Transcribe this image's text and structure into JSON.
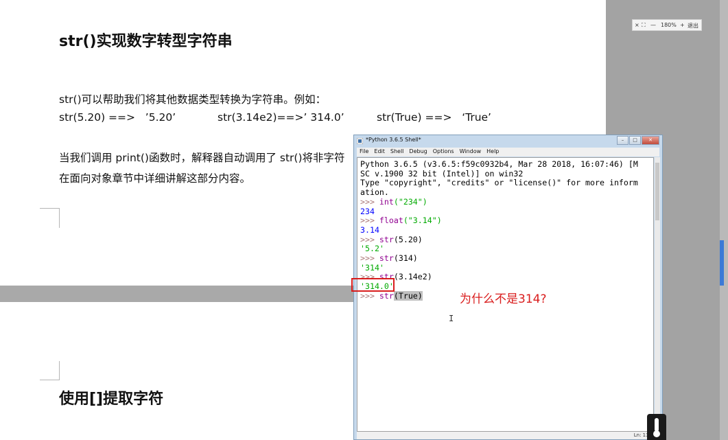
{
  "document": {
    "heading1": "str()实现数字转型字符串",
    "para1": "str()可以帮助我们将其他数据类型转换为字符串。例如：",
    "examples": [
      "str(5.20) ==>   ’5.20’",
      "str(3.14e2)==>’ 314.0’",
      "str(True) ==>   ‘True’"
    ],
    "para2_line1": "当我们调用 print()函数时，解释器自动调用了 str()将非字符",
    "para2_line2": "在面向对象章节中详细讲解这部分内容。",
    "heading2": "使用[]提取字符"
  },
  "zoom": {
    "level": "180%",
    "minus": "—",
    "plus": "+",
    "exit": "退出"
  },
  "python_window": {
    "title": "*Python 3.6.5 Shell*",
    "menu": [
      "File",
      "Edit",
      "Shell",
      "Debug",
      "Options",
      "Window",
      "Help"
    ],
    "status": "Ln: 13  Co",
    "lines": [
      {
        "kind": "plain",
        "text": "Python 3.6.5 (v3.6.5:f59c0932b4, Mar 28 2018, 16:07:46) [M"
      },
      {
        "kind": "plain",
        "text": "SC v.1900 32 bit (Intel)] on win32"
      },
      {
        "kind": "plain",
        "text": "Type \"copyright\", \"credits\" or \"license()\" for more inform"
      },
      {
        "kind": "plain",
        "text": "ation."
      },
      {
        "kind": "cmd",
        "prompt": ">>> ",
        "fn": "int",
        "arg": "(\"234\")"
      },
      {
        "kind": "out",
        "text": "234"
      },
      {
        "kind": "cmd",
        "prompt": ">>> ",
        "fn": "float",
        "arg": "(\"3.14\")"
      },
      {
        "kind": "out",
        "text": "3.14"
      },
      {
        "kind": "cmd",
        "prompt": ">>> ",
        "fn": "str",
        "arg": "(5.20)"
      },
      {
        "kind": "out",
        "text": "'5.2'"
      },
      {
        "kind": "cmd",
        "prompt": ">>> ",
        "fn": "str",
        "arg": "(314)"
      },
      {
        "kind": "out",
        "text": "'314'"
      },
      {
        "kind": "cmd",
        "prompt": ">>> ",
        "fn": "str",
        "arg": "(3.14e2)"
      },
      {
        "kind": "out",
        "text": "'314.0'"
      },
      {
        "kind": "cmd",
        "prompt": ">>> ",
        "fn": "str",
        "arg": "(True)"
      }
    ]
  },
  "annotation": "为什么不是314?"
}
